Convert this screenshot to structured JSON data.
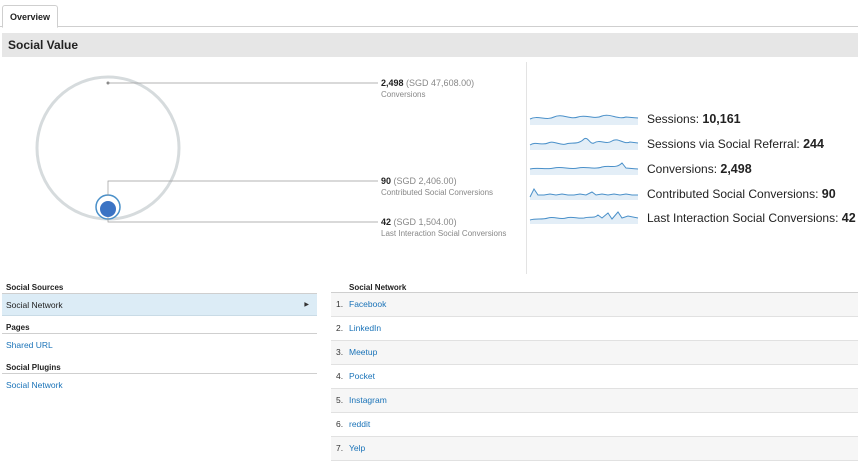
{
  "tabs": [
    {
      "label": "Overview"
    }
  ],
  "section": {
    "title": "Social Value"
  },
  "funnel": {
    "conversions": {
      "value": "2,498",
      "amount": "(SGD 47,608.00)",
      "label": "Conversions"
    },
    "contributed": {
      "value": "90",
      "amount": "(SGD 2,406.00)",
      "label": "Contributed Social Conversions"
    },
    "last_interaction": {
      "value": "42",
      "amount": "(SGD 1,504.00)",
      "label": "Last Interaction Social Conversions"
    }
  },
  "metrics": [
    {
      "label": "Sessions:",
      "value": "10,161"
    },
    {
      "label": "Sessions via Social Referral:",
      "value": "244"
    },
    {
      "label": "Conversions:",
      "value": "2,498"
    },
    {
      "label": "Contributed Social Conversions:",
      "value": "90"
    },
    {
      "label": "Last Interaction Social Conversions:",
      "value": "42"
    }
  ],
  "nav": {
    "social_sources": {
      "heading": "Social Sources",
      "items": [
        {
          "label": "Social Network"
        }
      ]
    },
    "pages": {
      "heading": "Pages",
      "items": [
        {
          "label": "Shared URL"
        }
      ]
    },
    "social_plugins": {
      "heading": "Social Plugins",
      "items": [
        {
          "label": "Social Network"
        }
      ]
    }
  },
  "table": {
    "header": "Social Network",
    "rows": [
      {
        "num": "1.",
        "name": "Facebook"
      },
      {
        "num": "2.",
        "name": "LinkedIn"
      },
      {
        "num": "3.",
        "name": "Meetup"
      },
      {
        "num": "4.",
        "name": "Pocket"
      },
      {
        "num": "5.",
        "name": "Instagram"
      },
      {
        "num": "6.",
        "name": "reddit"
      },
      {
        "num": "7.",
        "name": "Yelp"
      }
    ]
  },
  "colors": {
    "accent": "#1a73b8",
    "sparkline": "#4a90c9",
    "circle": "#d3d8da",
    "selected": "#dcecf6"
  }
}
